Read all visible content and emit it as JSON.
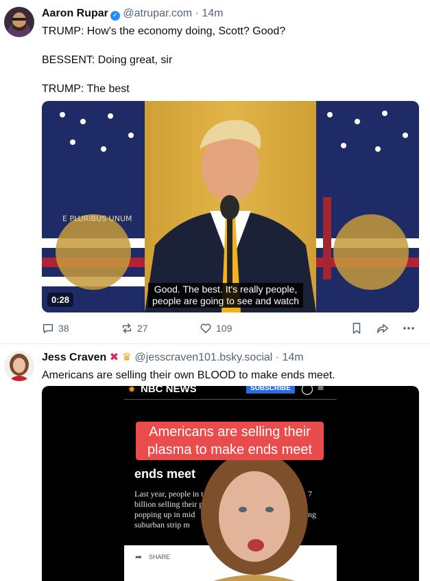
{
  "posts": [
    {
      "author": "Aaron Rupar",
      "handle": "@atrupar.com",
      "time": "· 14m",
      "lines": [
        "TRUMP: How's the economy doing, Scott? Good?",
        "BESSENT: Doing great, sir",
        "TRUMP: The best"
      ],
      "video": {
        "duration": "0:28",
        "caption_line1": "Good. The best. It's really people,",
        "caption_line2": "people are going to see and watch"
      },
      "actions": {
        "replies": "38",
        "reposts": "27",
        "likes": "109"
      }
    },
    {
      "author": "Jess Craven",
      "handle": "@jesscraven101.bsky.social",
      "time": "· 14m",
      "text": "Americans are selling their own BLOOD to make ends meet.",
      "image": {
        "brand": "NBC NEWS",
        "subscribe": "SUBSCRIBE",
        "article_headline_tail": "ends meet",
        "article_body": [
          "Last year, people in t",
          "billion selling their p",
          "popping up in mid",
          "suburban strip m"
        ],
        "article_body_right": [
          "7",
          "ng"
        ],
        "overlay_text": "Americans are selling their plasma to make ends meet",
        "share": "SHARE"
      }
    }
  ],
  "colors": {
    "muted": "#52647a",
    "divider": "#e5e9ee",
    "link_blue": "#208bfe",
    "overlay_red": "#ea4b4b"
  }
}
